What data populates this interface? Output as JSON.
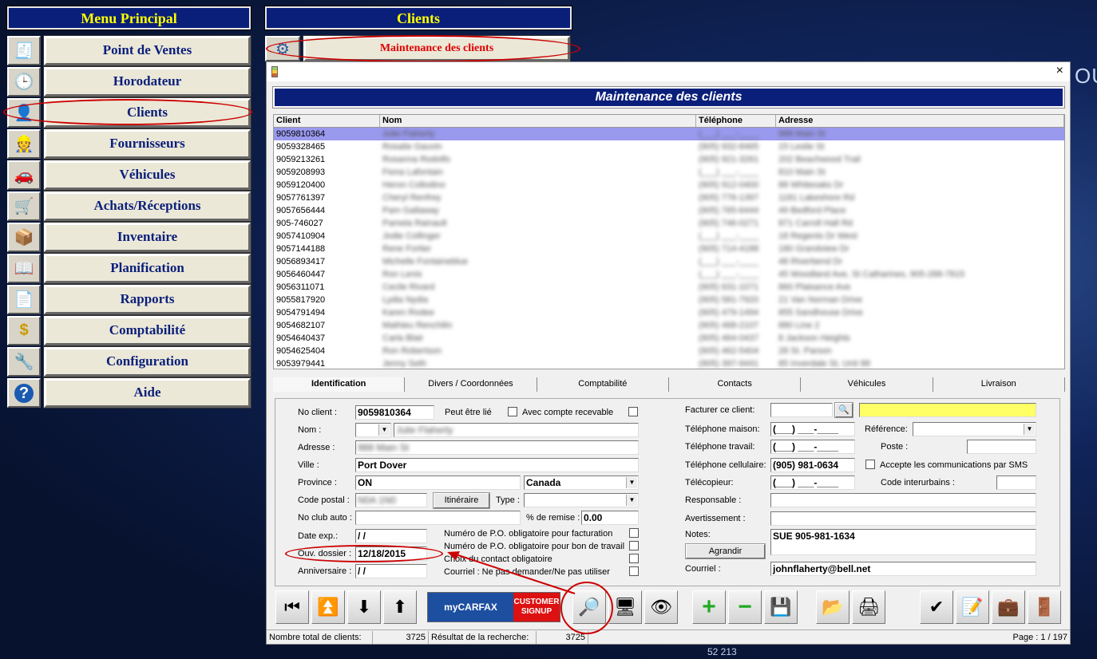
{
  "background": {
    "text_right": "OUT",
    "text_bottom": "52 213"
  },
  "menu": {
    "title": "Menu Principal",
    "items": [
      {
        "label": "Point de Ventes",
        "icon": "cash-register-icon"
      },
      {
        "label": "Horodateur",
        "icon": "clock-icon"
      },
      {
        "label": "Clients",
        "icon": "client-person-icon"
      },
      {
        "label": "Fournisseurs",
        "icon": "supplier-person-icon"
      },
      {
        "label": "Véhicules",
        "icon": "car-icon"
      },
      {
        "label": "Achats/Réceptions",
        "icon": "cart-icon"
      },
      {
        "label": "Inventaire",
        "icon": "inventory-icon"
      },
      {
        "label": "Planification",
        "icon": "book-icon"
      },
      {
        "label": "Rapports",
        "icon": "report-icon"
      },
      {
        "label": "Comptabilité",
        "icon": "dollar-icon"
      },
      {
        "label": "Configuration",
        "icon": "tools-icon"
      },
      {
        "label": "Aide",
        "icon": "help-icon"
      }
    ]
  },
  "clients_panel": {
    "title": "Clients",
    "maintenance_label": "Maintenance des clients"
  },
  "window": {
    "banner": "Maintenance des clients",
    "close": "×"
  },
  "grid": {
    "headers": [
      "Client",
      "Nom",
      "Téléphone",
      "Adresse"
    ],
    "rows": [
      {
        "client": "9059810364",
        "nom": "Julie Flaherty",
        "tel": "(___) ___-____",
        "adresse": "988 Main St"
      },
      {
        "client": "9059328465",
        "nom": "Rosalie Gauvin",
        "tel": "(905) 932-8465",
        "adresse": "15 Leslie St"
      },
      {
        "client": "9059213261",
        "nom": "Rosanna Rodolfo",
        "tel": "(905) 921-3261",
        "adresse": "202 Beachwood Trail"
      },
      {
        "client": "9059208993",
        "nom": "Fiona Lafontain",
        "tel": "(___) ___-____",
        "adresse": "810 Main St"
      },
      {
        "client": "9059120400",
        "nom": "Heron Collodino",
        "tel": "(905) 912-0400",
        "adresse": "88 Whiteoaks Dr"
      },
      {
        "client": "9057761397",
        "nom": "Cheryl Renfrey",
        "tel": "(905) 776-1397",
        "adresse": "1181 Lakeshore Rd"
      },
      {
        "client": "9057656444",
        "nom": "Pam Gallaway",
        "tel": "(905) 765-6444",
        "adresse": "49 Bedford Place"
      },
      {
        "client": "905-746027",
        "nom": "Pamela Rainault",
        "tel": "(905) 746-0271",
        "adresse": "871 Carroll Hall Rd"
      },
      {
        "client": "9057410904",
        "nom": "Jodie Collinger",
        "tel": "(___) ___-____",
        "adresse": "18 Regents Dr West"
      },
      {
        "client": "9057144188",
        "nom": "Rene Fortier",
        "tel": "(905) 714-4188",
        "adresse": "180 Grandview Dr"
      },
      {
        "client": "9056893417",
        "nom": "Michelle Fontaineblue",
        "tel": "(___) ___-____",
        "adresse": "48 Riverbend Dr"
      },
      {
        "client": "9056460447",
        "nom": "Ron Lenis",
        "tel": "(___) ___-____",
        "adresse": "45 Woodland Ave, St Catharines, 905-288-7815"
      },
      {
        "client": "9056311071",
        "nom": "Cecile Rivard",
        "tel": "(905) 631-1071",
        "adresse": "860 Plaisance Ave"
      },
      {
        "client": "9055817920",
        "nom": "Lydia Nydia",
        "tel": "(905) 581-7920",
        "adresse": "21 Van Norman Drive"
      },
      {
        "client": "9054791494",
        "nom": "Karen Rodee",
        "tel": "(905) 479-1494",
        "adresse": "855 Sandhouse Drive"
      },
      {
        "client": "9054682107",
        "nom": "Mathieu Renchilin",
        "tel": "(905) 468-2107",
        "adresse": "880 Line 2"
      },
      {
        "client": "9054640437",
        "nom": "Carla Blair",
        "tel": "(905) 464-0437",
        "adresse": "8 Jackson Heights"
      },
      {
        "client": "9054625404",
        "nom": "Ron Robertson",
        "tel": "(905) 462-5404",
        "adresse": "28 St. Parson"
      },
      {
        "client": "9053979441",
        "nom": "Jenny Seth",
        "tel": "(905) 397-9441",
        "adresse": "85 Inverdale St, Unit 88"
      }
    ]
  },
  "tabs": [
    "Identification",
    "Divers / Coordonnées",
    "Comptabilité",
    "Contacts",
    "Véhicules",
    "Livraison"
  ],
  "form": {
    "no_client_label": "No client :",
    "no_client": "9059810364",
    "peut_etre_lie": "Peut être lié",
    "avec_compte": "Avec compte recevable",
    "nom_label": "Nom :",
    "nom_value": "Julie Flaherty",
    "adresse_label": "Adresse :",
    "adresse_value": "988 Main St",
    "ville_label": "Ville :",
    "ville": "Port Dover",
    "province_label": "Province :",
    "province": "ON",
    "pays": "Canada",
    "code_postal_label": "Code postal :",
    "code_postal": "N0A 1N0",
    "itineraire": "Itinéraire",
    "type_label": "Type :",
    "no_club_label": "No club auto :",
    "remise_label": "% de remise :",
    "remise": "0.00",
    "date_exp_label": "Date exp.:",
    "date_exp": " /  /",
    "ouv_label": "Ouv. dossier :",
    "ouv": "12/18/2015",
    "anniv_label": "Anniversaire :",
    "anniv": " /  /",
    "po_fact": "Numéro de P.O. obligatoire pour facturation",
    "po_bon": "Numéro de P.O. obligatoire pour bon de travail",
    "choix_contact": "Choix du contact obligatoire",
    "courriel_pas": "Courriel : Ne pas demander/Ne pas utiliser",
    "facturer_label": "Facturer ce client:",
    "tel_maison_label": "Téléphone maison:",
    "tel_maison": "(___) ___-____",
    "tel_travail_label": "Téléphone travail:",
    "tel_travail": "(___) ___-____",
    "tel_cell_label": "Téléphone cellulaire:",
    "tel_cell": "(905) 981-0634",
    "telecopieur_label": "Télécopieur:",
    "telecopieur": "(___) ___-____",
    "reference_label": "Référence:",
    "poste_label": "Poste :",
    "sms_label": "Accepte les communications par SMS",
    "code_inter_label": "Code interurbains :",
    "responsable_label": "Responsable :",
    "avert_label": "Avertissement :",
    "notes_label": "Notes:",
    "notes": "SUE  905-981-1634",
    "agrandir": "Agrandir",
    "courriel_label": "Courriel :",
    "courriel": "johnflaherty@bell.net"
  },
  "carfax": {
    "brand": "myCARFAX",
    "signup_1": "CUSTOMER",
    "signup_2": "SIGNUP"
  },
  "status": {
    "total_label": "Nombre total de clients:",
    "total": "3725",
    "result_label": "Résultat de la recherche:",
    "result": "3725",
    "page": "Page : 1 / 197"
  }
}
